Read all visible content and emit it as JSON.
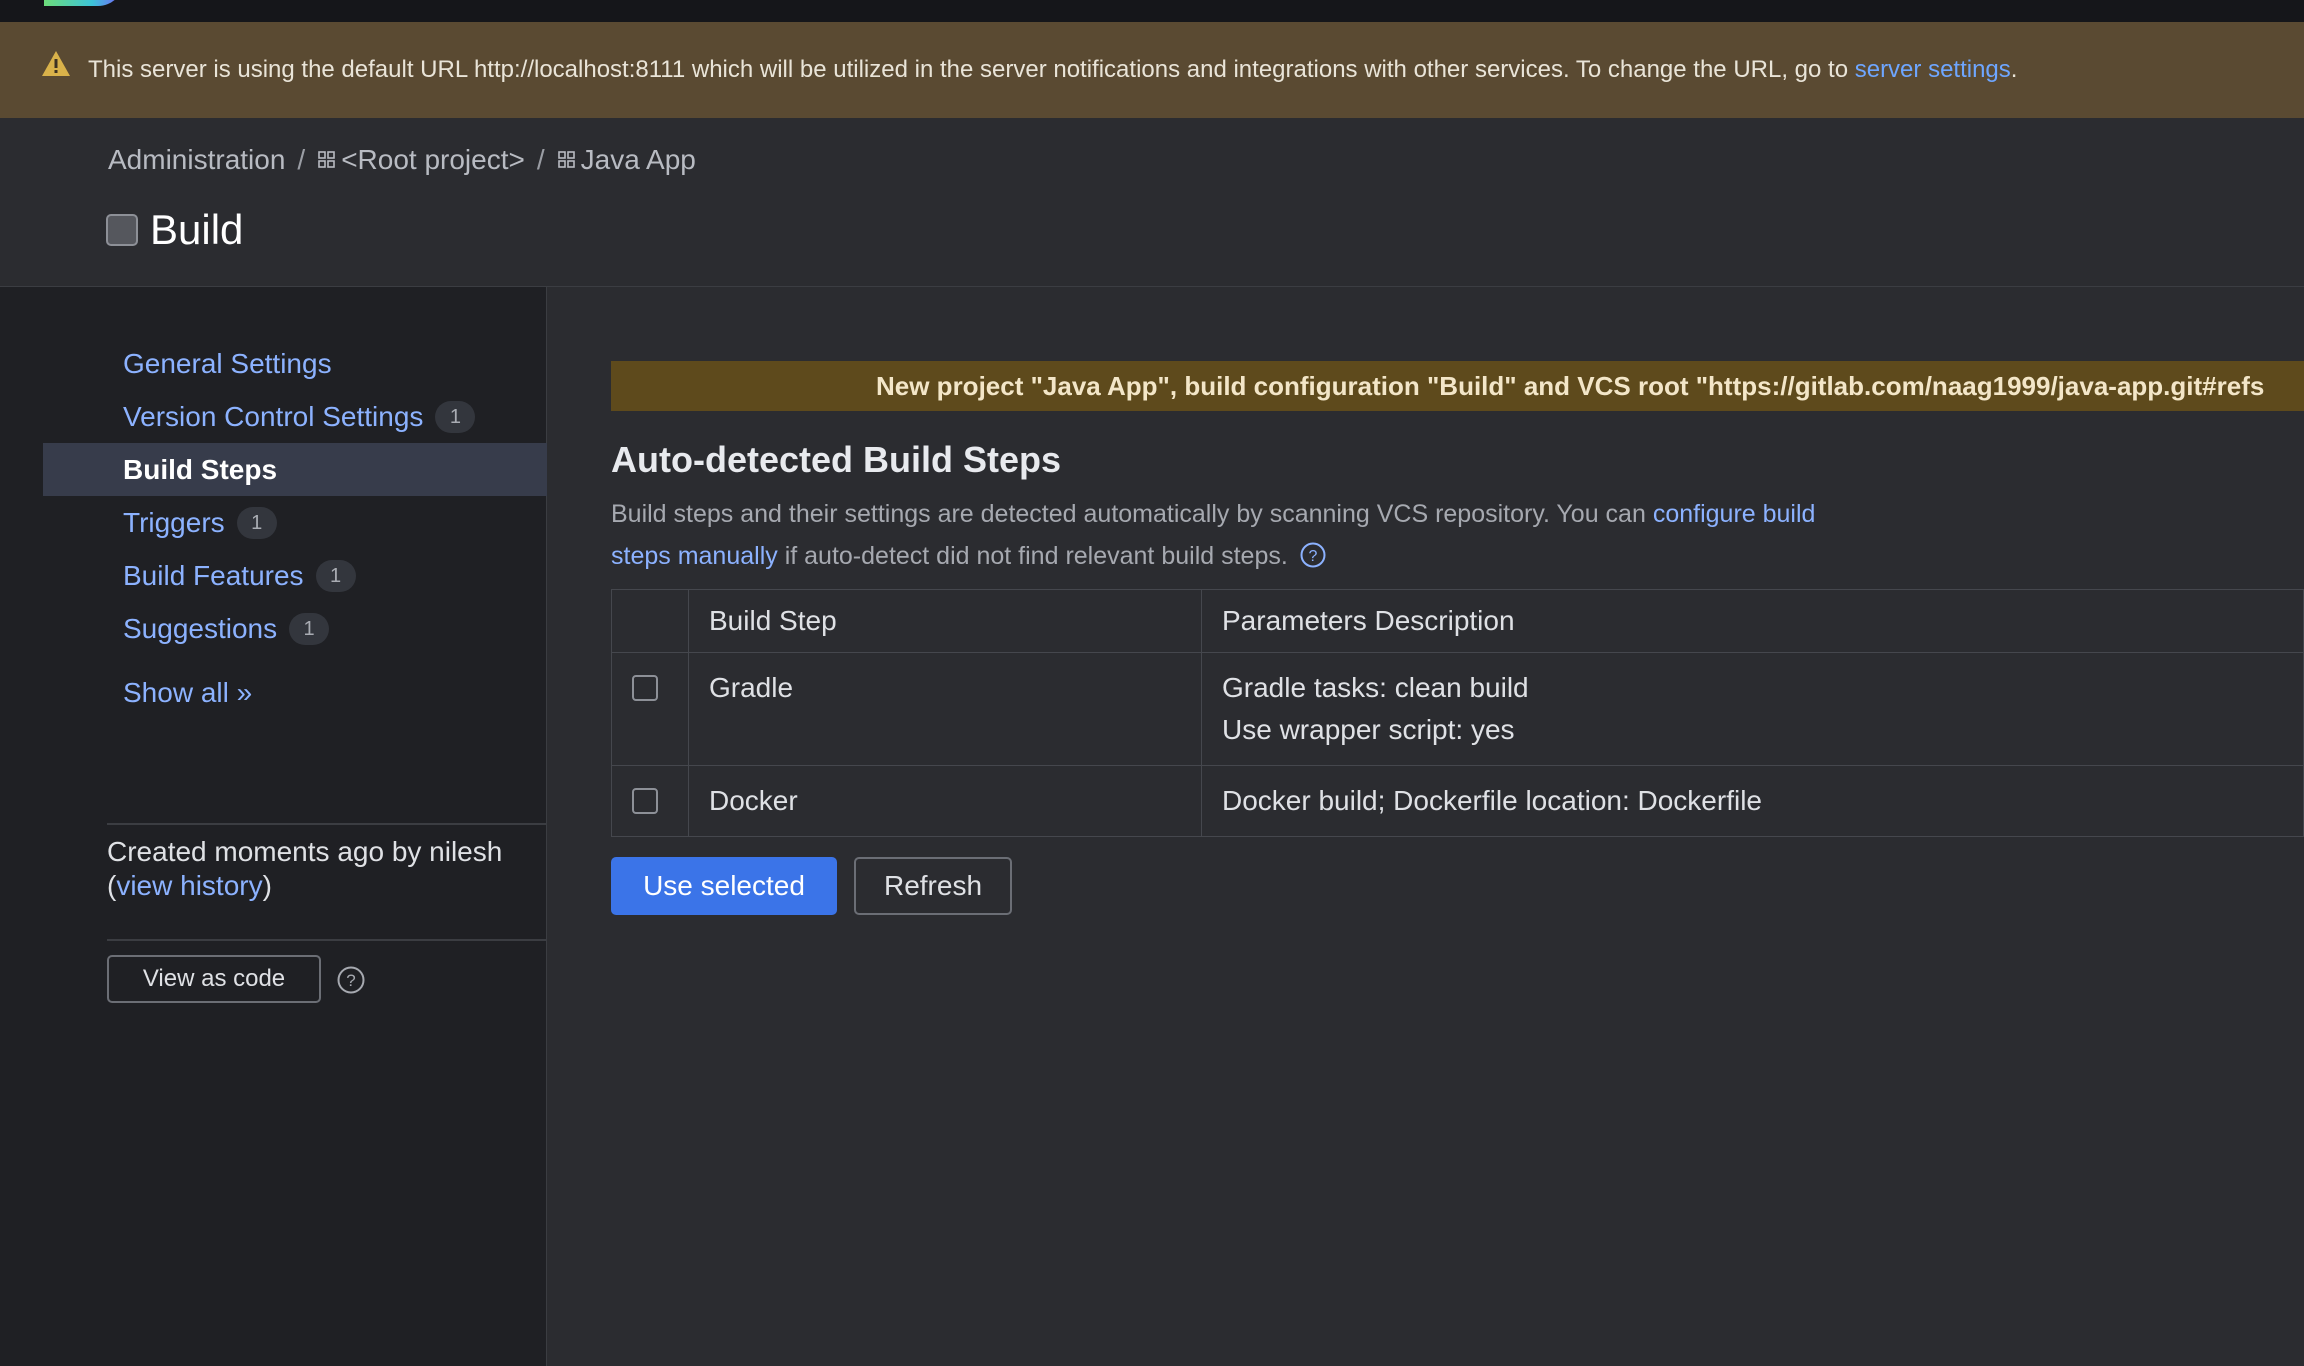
{
  "banner": {
    "text": "This server is using the default URL http://localhost:8111 which will be utilized in the server notifications and integrations with other services. To change the URL, go to",
    "link_label": "server settings",
    "suffix": ".",
    "icon": "warning-icon"
  },
  "breadcrumb": {
    "items": [
      "Administration",
      "<Root project>",
      "Java App"
    ],
    "separator": "/"
  },
  "page": {
    "title": "Build"
  },
  "sidebar": {
    "items": [
      {
        "label": "General Settings",
        "badge": ""
      },
      {
        "label": "Version Control Settings",
        "badge": "1"
      },
      {
        "label": "Build Steps",
        "badge": "",
        "active": true
      },
      {
        "label": "Triggers",
        "badge": "1"
      },
      {
        "label": "Build Features",
        "badge": "1"
      },
      {
        "label": "Suggestions",
        "badge": "1"
      }
    ],
    "show_all": "Show all »",
    "created_text": "Created moments ago by nilesh",
    "history_open": "(",
    "history_link": "view history",
    "history_close": ")",
    "view_as_code": "View as code"
  },
  "main": {
    "notice": "New project \"Java App\", build configuration \"Build\" and VCS root \"https://gitlab.com/naag1999/java-app.git#refs",
    "section_title": "Auto-detected Build Steps",
    "desc_prefix": "Build steps and their settings are detected automatically by scanning VCS repository. You can",
    "desc_link": "configure build steps manually",
    "desc_suffix": "if auto-detect did not find relevant build steps.",
    "table": {
      "headers": [
        "Build Step",
        "Parameters Description"
      ],
      "rows": [
        {
          "step": "Gradle",
          "params": [
            "Gradle tasks: clean build",
            "Use wrapper script: yes"
          ]
        },
        {
          "step": "Docker",
          "params": [
            "Docker build; Dockerfile location: Dockerfile"
          ]
        }
      ]
    },
    "buttons": {
      "use_selected": "Use selected",
      "refresh": "Refresh"
    }
  },
  "colors": {
    "accent": "#3b74e8",
    "link": "#8cb2ff",
    "banner_bg": "#5a4a32",
    "notice_bg": "#5e4a1c"
  }
}
